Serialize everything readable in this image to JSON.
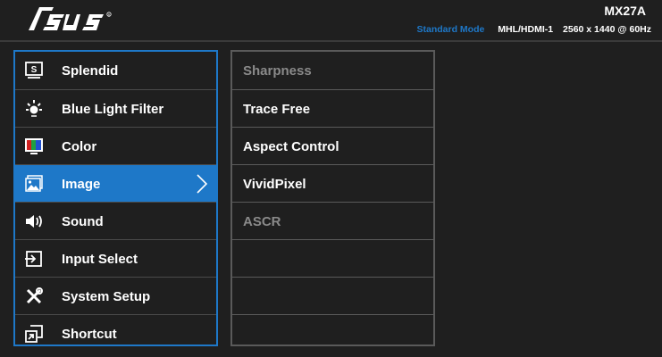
{
  "header": {
    "logo_text": "/ISUS",
    "model": "MX27A",
    "mode": "Standard Mode",
    "input": "MHL/HDMI-1",
    "resolution": "2560 x 1440 @ 60Hz"
  },
  "main_menu": {
    "items": [
      {
        "label": "Splendid",
        "icon": "splendid-icon"
      },
      {
        "label": "Blue Light Filter",
        "icon": "blue-light-filter-icon"
      },
      {
        "label": "Color",
        "icon": "color-icon"
      },
      {
        "label": "Image",
        "icon": "image-icon",
        "selected": true
      },
      {
        "label": "Sound",
        "icon": "sound-icon"
      },
      {
        "label": "Input Select",
        "icon": "input-select-icon"
      },
      {
        "label": "System Setup",
        "icon": "system-setup-icon"
      },
      {
        "label": "Shortcut",
        "icon": "shortcut-icon"
      }
    ]
  },
  "sub_menu": {
    "items": [
      {
        "label": "Sharpness",
        "enabled": false
      },
      {
        "label": "Trace Free",
        "enabled": true
      },
      {
        "label": "Aspect Control",
        "enabled": true
      },
      {
        "label": "VividPixel",
        "enabled": true
      },
      {
        "label": "ASCR",
        "enabled": false
      },
      {
        "label": "",
        "enabled": false
      },
      {
        "label": "",
        "enabled": false
      },
      {
        "label": "",
        "enabled": false
      }
    ]
  },
  "colors": {
    "accent": "#1e78c8",
    "background": "#1f1f1f",
    "disabled_text": "#8a8a8a"
  }
}
